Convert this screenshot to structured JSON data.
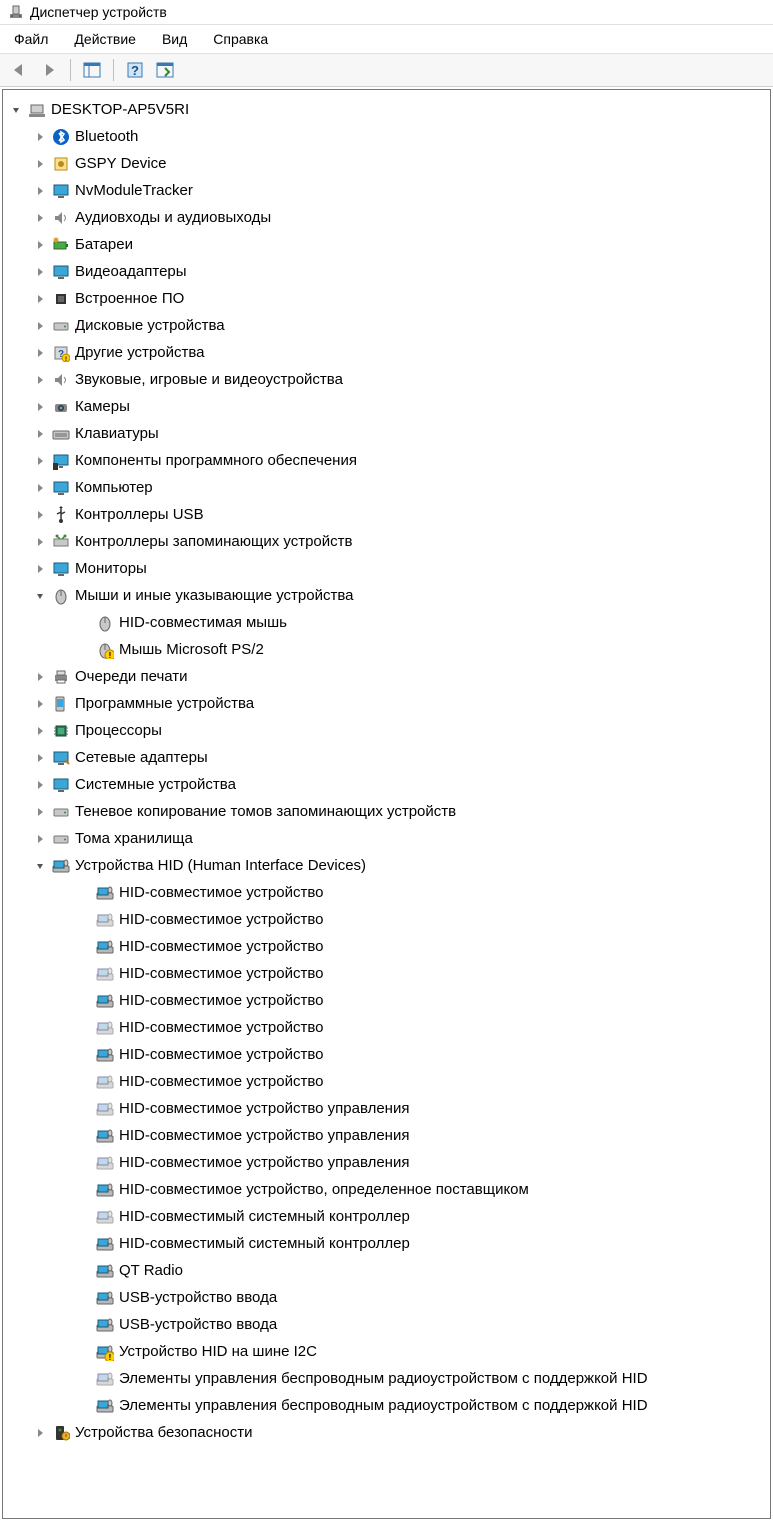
{
  "window": {
    "title": "Диспетчер устройств"
  },
  "menu": {
    "file": "Файл",
    "action": "Действие",
    "view": "Вид",
    "help": "Справка"
  },
  "tree": {
    "root": {
      "label": "DESKTOP-AP5V5RI",
      "expanded": true,
      "icon": "computer"
    },
    "categories": [
      {
        "label": "Bluetooth",
        "icon": "bluetooth",
        "expanded": false
      },
      {
        "label": "GSPY Device",
        "icon": "gspy",
        "expanded": false
      },
      {
        "label": "NvModuleTracker",
        "icon": "monitor",
        "expanded": false
      },
      {
        "label": "Аудиовходы и аудиовыходы",
        "icon": "speaker",
        "expanded": false
      },
      {
        "label": "Батареи",
        "icon": "battery",
        "expanded": false
      },
      {
        "label": "Видеоадаптеры",
        "icon": "monitor",
        "expanded": false
      },
      {
        "label": "Встроенное ПО",
        "icon": "chip",
        "expanded": false
      },
      {
        "label": "Дисковые устройства",
        "icon": "disk",
        "expanded": false
      },
      {
        "label": "Другие устройства",
        "icon": "unknown",
        "expanded": false
      },
      {
        "label": "Звуковые, игровые и видеоустройства",
        "icon": "speaker",
        "expanded": false
      },
      {
        "label": "Камеры",
        "icon": "camera",
        "expanded": false
      },
      {
        "label": "Клавиатуры",
        "icon": "keyboard",
        "expanded": false
      },
      {
        "label": "Компоненты программного обеспечения",
        "icon": "software",
        "expanded": false
      },
      {
        "label": "Компьютер",
        "icon": "monitor",
        "expanded": false
      },
      {
        "label": "Контроллеры USB",
        "icon": "usb",
        "expanded": false
      },
      {
        "label": "Контроллеры запоминающих устройств",
        "icon": "storagectl",
        "expanded": false
      },
      {
        "label": "Мониторы",
        "icon": "monitor",
        "expanded": false
      },
      {
        "label": "Мыши и иные указывающие устройства",
        "icon": "mouse",
        "expanded": true,
        "children": [
          {
            "label": "HID-совместимая мышь",
            "icon": "mouse",
            "warn": false
          },
          {
            "label": "Мышь Microsoft PS/2",
            "icon": "mouse",
            "warn": true
          }
        ]
      },
      {
        "label": "Очереди печати",
        "icon": "printer",
        "expanded": false
      },
      {
        "label": "Программные устройства",
        "icon": "softdev",
        "expanded": false
      },
      {
        "label": "Процессоры",
        "icon": "cpu",
        "expanded": false
      },
      {
        "label": "Сетевые адаптеры",
        "icon": "network",
        "expanded": false
      },
      {
        "label": "Системные устройства",
        "icon": "monitor",
        "expanded": false
      },
      {
        "label": "Теневое копирование томов запоминающих устройств",
        "icon": "disk",
        "expanded": false
      },
      {
        "label": "Тома хранилища",
        "icon": "disk",
        "expanded": false
      },
      {
        "label": "Устройства HID (Human Interface Devices)",
        "icon": "hid",
        "expanded": true,
        "children": [
          {
            "label": "HID-совместимое устройство",
            "icon": "hid",
            "warn": false
          },
          {
            "label": "HID-совместимое устройство",
            "icon": "hid-dim",
            "warn": false
          },
          {
            "label": "HID-совместимое устройство",
            "icon": "hid",
            "warn": false
          },
          {
            "label": "HID-совместимое устройство",
            "icon": "hid-dim",
            "warn": false
          },
          {
            "label": "HID-совместимое устройство",
            "icon": "hid",
            "warn": false
          },
          {
            "label": "HID-совместимое устройство",
            "icon": "hid-dim",
            "warn": false
          },
          {
            "label": "HID-совместимое устройство",
            "icon": "hid",
            "warn": false
          },
          {
            "label": "HID-совместимое устройство",
            "icon": "hid-dim",
            "warn": false
          },
          {
            "label": "HID-совместимое устройство управления",
            "icon": "hid-dim",
            "warn": false
          },
          {
            "label": "HID-совместимое устройство управления",
            "icon": "hid",
            "warn": false
          },
          {
            "label": "HID-совместимое устройство управления",
            "icon": "hid-dim",
            "warn": false
          },
          {
            "label": "HID-совместимое устройство, определенное поставщиком",
            "icon": "hid",
            "warn": false
          },
          {
            "label": "HID-совместимый системный контроллер",
            "icon": "hid-dim",
            "warn": false
          },
          {
            "label": "HID-совместимый системный контроллер",
            "icon": "hid",
            "warn": false
          },
          {
            "label": "QT Radio",
            "icon": "hid",
            "warn": false
          },
          {
            "label": "USB-устройство ввода",
            "icon": "hid",
            "warn": false
          },
          {
            "label": "USB-устройство ввода",
            "icon": "hid",
            "warn": false
          },
          {
            "label": "Устройство HID на шине I2C",
            "icon": "hid",
            "warn": true
          },
          {
            "label": "Элементы управления беспроводным радиоустройством с поддержкой HID",
            "icon": "hid-dim",
            "warn": false
          },
          {
            "label": "Элементы управления беспроводным радиоустройством с поддержкой HID",
            "icon": "hid",
            "warn": false
          }
        ]
      },
      {
        "label": "Устройства безопасности",
        "icon": "security",
        "expanded": false
      }
    ]
  }
}
